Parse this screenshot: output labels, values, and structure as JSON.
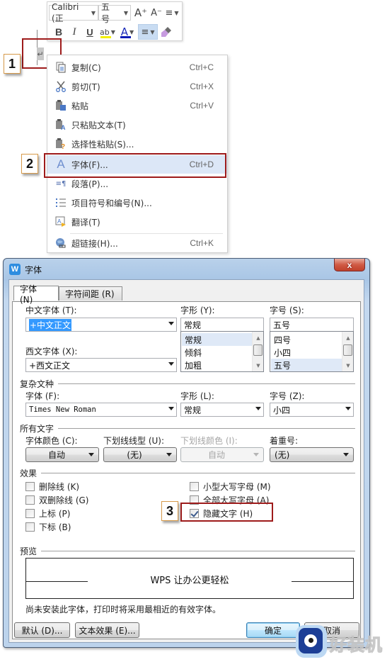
{
  "mini_toolbar": {
    "font_name": "Calibri (正",
    "font_size": "五号",
    "grow_font_icon": "A⁺",
    "shrink_font_icon": "A⁻",
    "line_spacing_icon": "≡",
    "bold": "B",
    "italic": "I",
    "underline": "U",
    "highlight": "ab",
    "font_color": "A",
    "align": "≡",
    "format_painter_icon": "brush",
    "colors": {
      "highlight": "#f3f000",
      "font_color": "#0a1bb8"
    }
  },
  "document": {
    "paragraph_mark": "↵"
  },
  "callouts": [
    {
      "number": "1"
    },
    {
      "number": "2"
    },
    {
      "number": "3"
    }
  ],
  "context_menu": {
    "items": [
      {
        "icon": "copy-icon",
        "label": "复制(C)",
        "shortcut": "Ctrl+C"
      },
      {
        "icon": "cut-icon",
        "label": "剪切(T)",
        "shortcut": "Ctrl+X"
      },
      {
        "icon": "paste-icon",
        "label": "粘贴",
        "shortcut": "Ctrl+V"
      },
      {
        "icon": "paste-text-icon",
        "label": "只粘贴文本(T)",
        "shortcut": ""
      },
      {
        "icon": "paste-special-icon",
        "label": "选择性粘贴(S)...",
        "shortcut": ""
      },
      {
        "icon": "font-icon",
        "label": "字体(F)...",
        "shortcut": "Ctrl+D",
        "highlighted": true
      },
      {
        "icon": "paragraph-icon",
        "label": "段落(P)...",
        "shortcut": ""
      },
      {
        "icon": "bullets-icon",
        "label": "项目符号和编号(N)...",
        "shortcut": ""
      },
      {
        "icon": "translate-icon",
        "label": "翻译(T)",
        "shortcut": ""
      },
      {
        "icon": "hyperlink-icon",
        "label": "超链接(H)...",
        "shortcut": "Ctrl+K"
      }
    ]
  },
  "dialog": {
    "title": "字体",
    "app_icon": "W",
    "close": "x",
    "tabs": [
      {
        "label": "字体 (N)",
        "active": true
      },
      {
        "label": "字符间距 (R)",
        "active": false
      }
    ],
    "chinese_font": {
      "label": "中文字体 (T):",
      "value": "+中文正文"
    },
    "western_font": {
      "label": "西文字体 (X):",
      "value": "+西文正文"
    },
    "style": {
      "label": "字形 (Y):",
      "value": "常规",
      "options": [
        "常规",
        "倾斜",
        "加粗"
      ],
      "selected": "常规"
    },
    "size": {
      "label": "字号 (S):",
      "value": "五号",
      "options": [
        "四号",
        "小四",
        "五号"
      ],
      "selected": "五号"
    },
    "complex_script": {
      "group_label": "复杂文种",
      "font_label": "字体 (F):",
      "font_value": "Times New Roman",
      "style_label": "字形 (L):",
      "style_value": "常规",
      "size_label": "字号 (Z):",
      "size_value": "小四"
    },
    "all_text": {
      "group_label": "所有文字",
      "font_color_label": "字体颜色 (C):",
      "font_color_value": "自动",
      "underline_style_label": "下划线线型 (U):",
      "underline_style_value": "(无)",
      "underline_color_label": "下划线颜色 (I):",
      "underline_color_value": "自动",
      "emphasis_label": "着重号:",
      "emphasis_value": "(无)"
    },
    "effects": {
      "group_label": "效果",
      "options": [
        {
          "label": "删除线 (K)",
          "checked": false
        },
        {
          "label": "双删除线 (G)",
          "checked": false
        },
        {
          "label": "上标 (P)",
          "checked": false
        },
        {
          "label": "下标 (B)",
          "checked": false
        },
        {
          "label": "小型大写字母 (M)",
          "checked": false
        },
        {
          "label": "全部大写字母 (A)",
          "checked": false
        },
        {
          "label": "隐藏文字 (H)",
          "checked": true
        }
      ]
    },
    "preview": {
      "group_label": "预览",
      "sample_text": "WPS 让办公更轻松",
      "note": "尚未安装此字体，打印时将采用最相近的有效字体。"
    },
    "buttons": {
      "default": "默认 (D)...",
      "text_effects": "文本效果 (E)...",
      "ok": "确定",
      "cancel": "取消"
    }
  },
  "watermark": {
    "text": "好装机"
  }
}
